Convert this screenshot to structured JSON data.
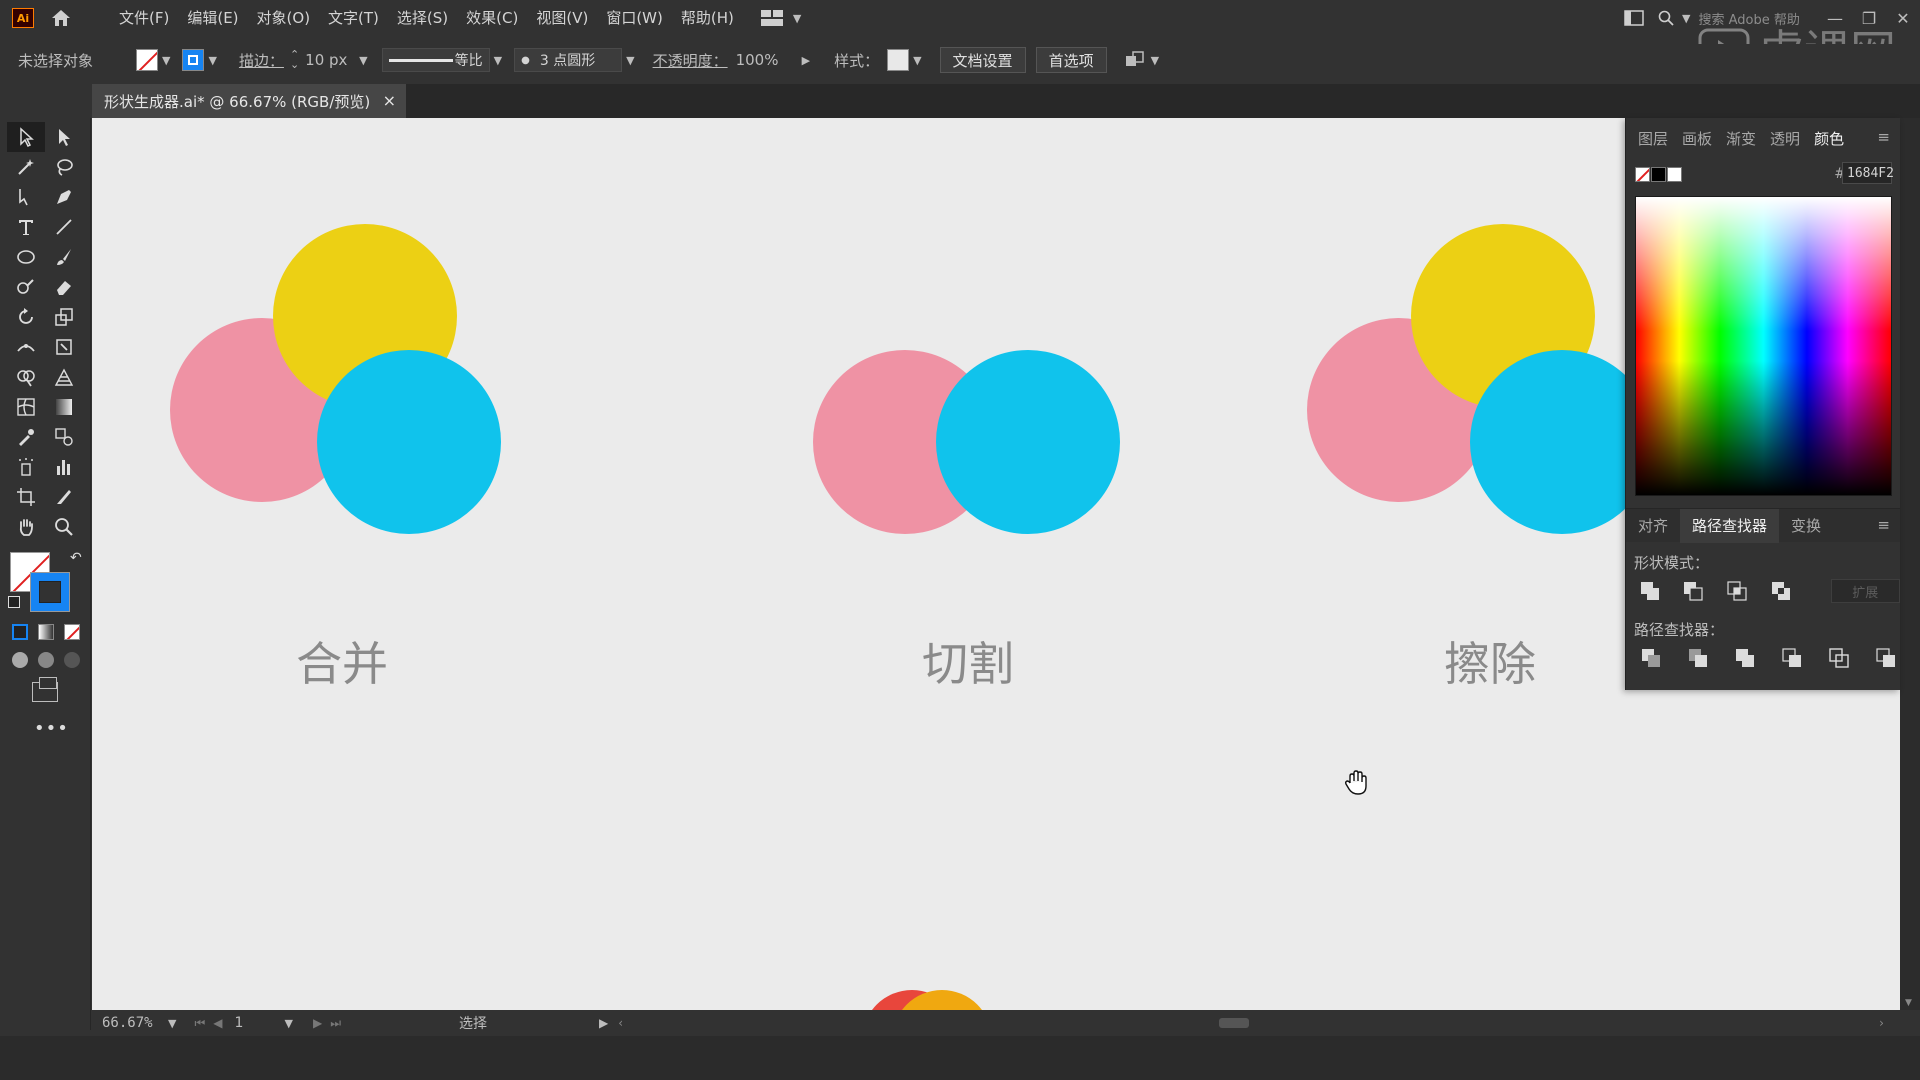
{
  "app": {
    "logo_text": "Ai",
    "menu": [
      "文件(F)",
      "编辑(E)",
      "对象(O)",
      "文字(T)",
      "选择(S)",
      "效果(C)",
      "视图(V)",
      "窗口(W)",
      "帮助(H)"
    ],
    "search_placeholder": "搜索 Adobe 帮助"
  },
  "control": {
    "selection": "未选择对象",
    "stroke_label": "描边：",
    "stroke_value": "10 px",
    "profile_label": "等比",
    "brush_label": "3 点圆形",
    "opacity_label": "不透明度：",
    "opacity_value": "100%",
    "style_label": "样式：",
    "doc_setup": "文档设置",
    "preferences": "首选项"
  },
  "document": {
    "tab_title": "形状生成器.ai* @ 66.67% (RGB/预览)",
    "close": "×"
  },
  "canvas": {
    "captions": [
      "合并",
      "切割",
      "擦除"
    ],
    "colors": {
      "pink": "#ef92a4",
      "yellow": "#ecd014",
      "cyan": "#10c3ec",
      "bottom_red": "#e8463c",
      "bottom_orange": "#f0a810"
    }
  },
  "status": {
    "zoom": "66.67%",
    "page": "1",
    "mode": "选择"
  },
  "panel": {
    "tabs": [
      "图层",
      "画板",
      "渐变",
      "透明",
      "颜色"
    ],
    "active_tab": "颜色",
    "hex_label": "#",
    "hex_value": "1684F2",
    "sub_tabs": [
      "对齐",
      "路径查找器",
      "变换"
    ],
    "active_sub_tab": "路径查找器",
    "shape_modes_label": "形状模式：",
    "pathfinders_label": "路径查找器：",
    "expand_label": "扩展"
  },
  "watermark": {
    "text": "虎课网"
  },
  "icons": [
    "home-icon",
    "workspace-icon",
    "search-icon",
    "hand-cursor-icon"
  ]
}
